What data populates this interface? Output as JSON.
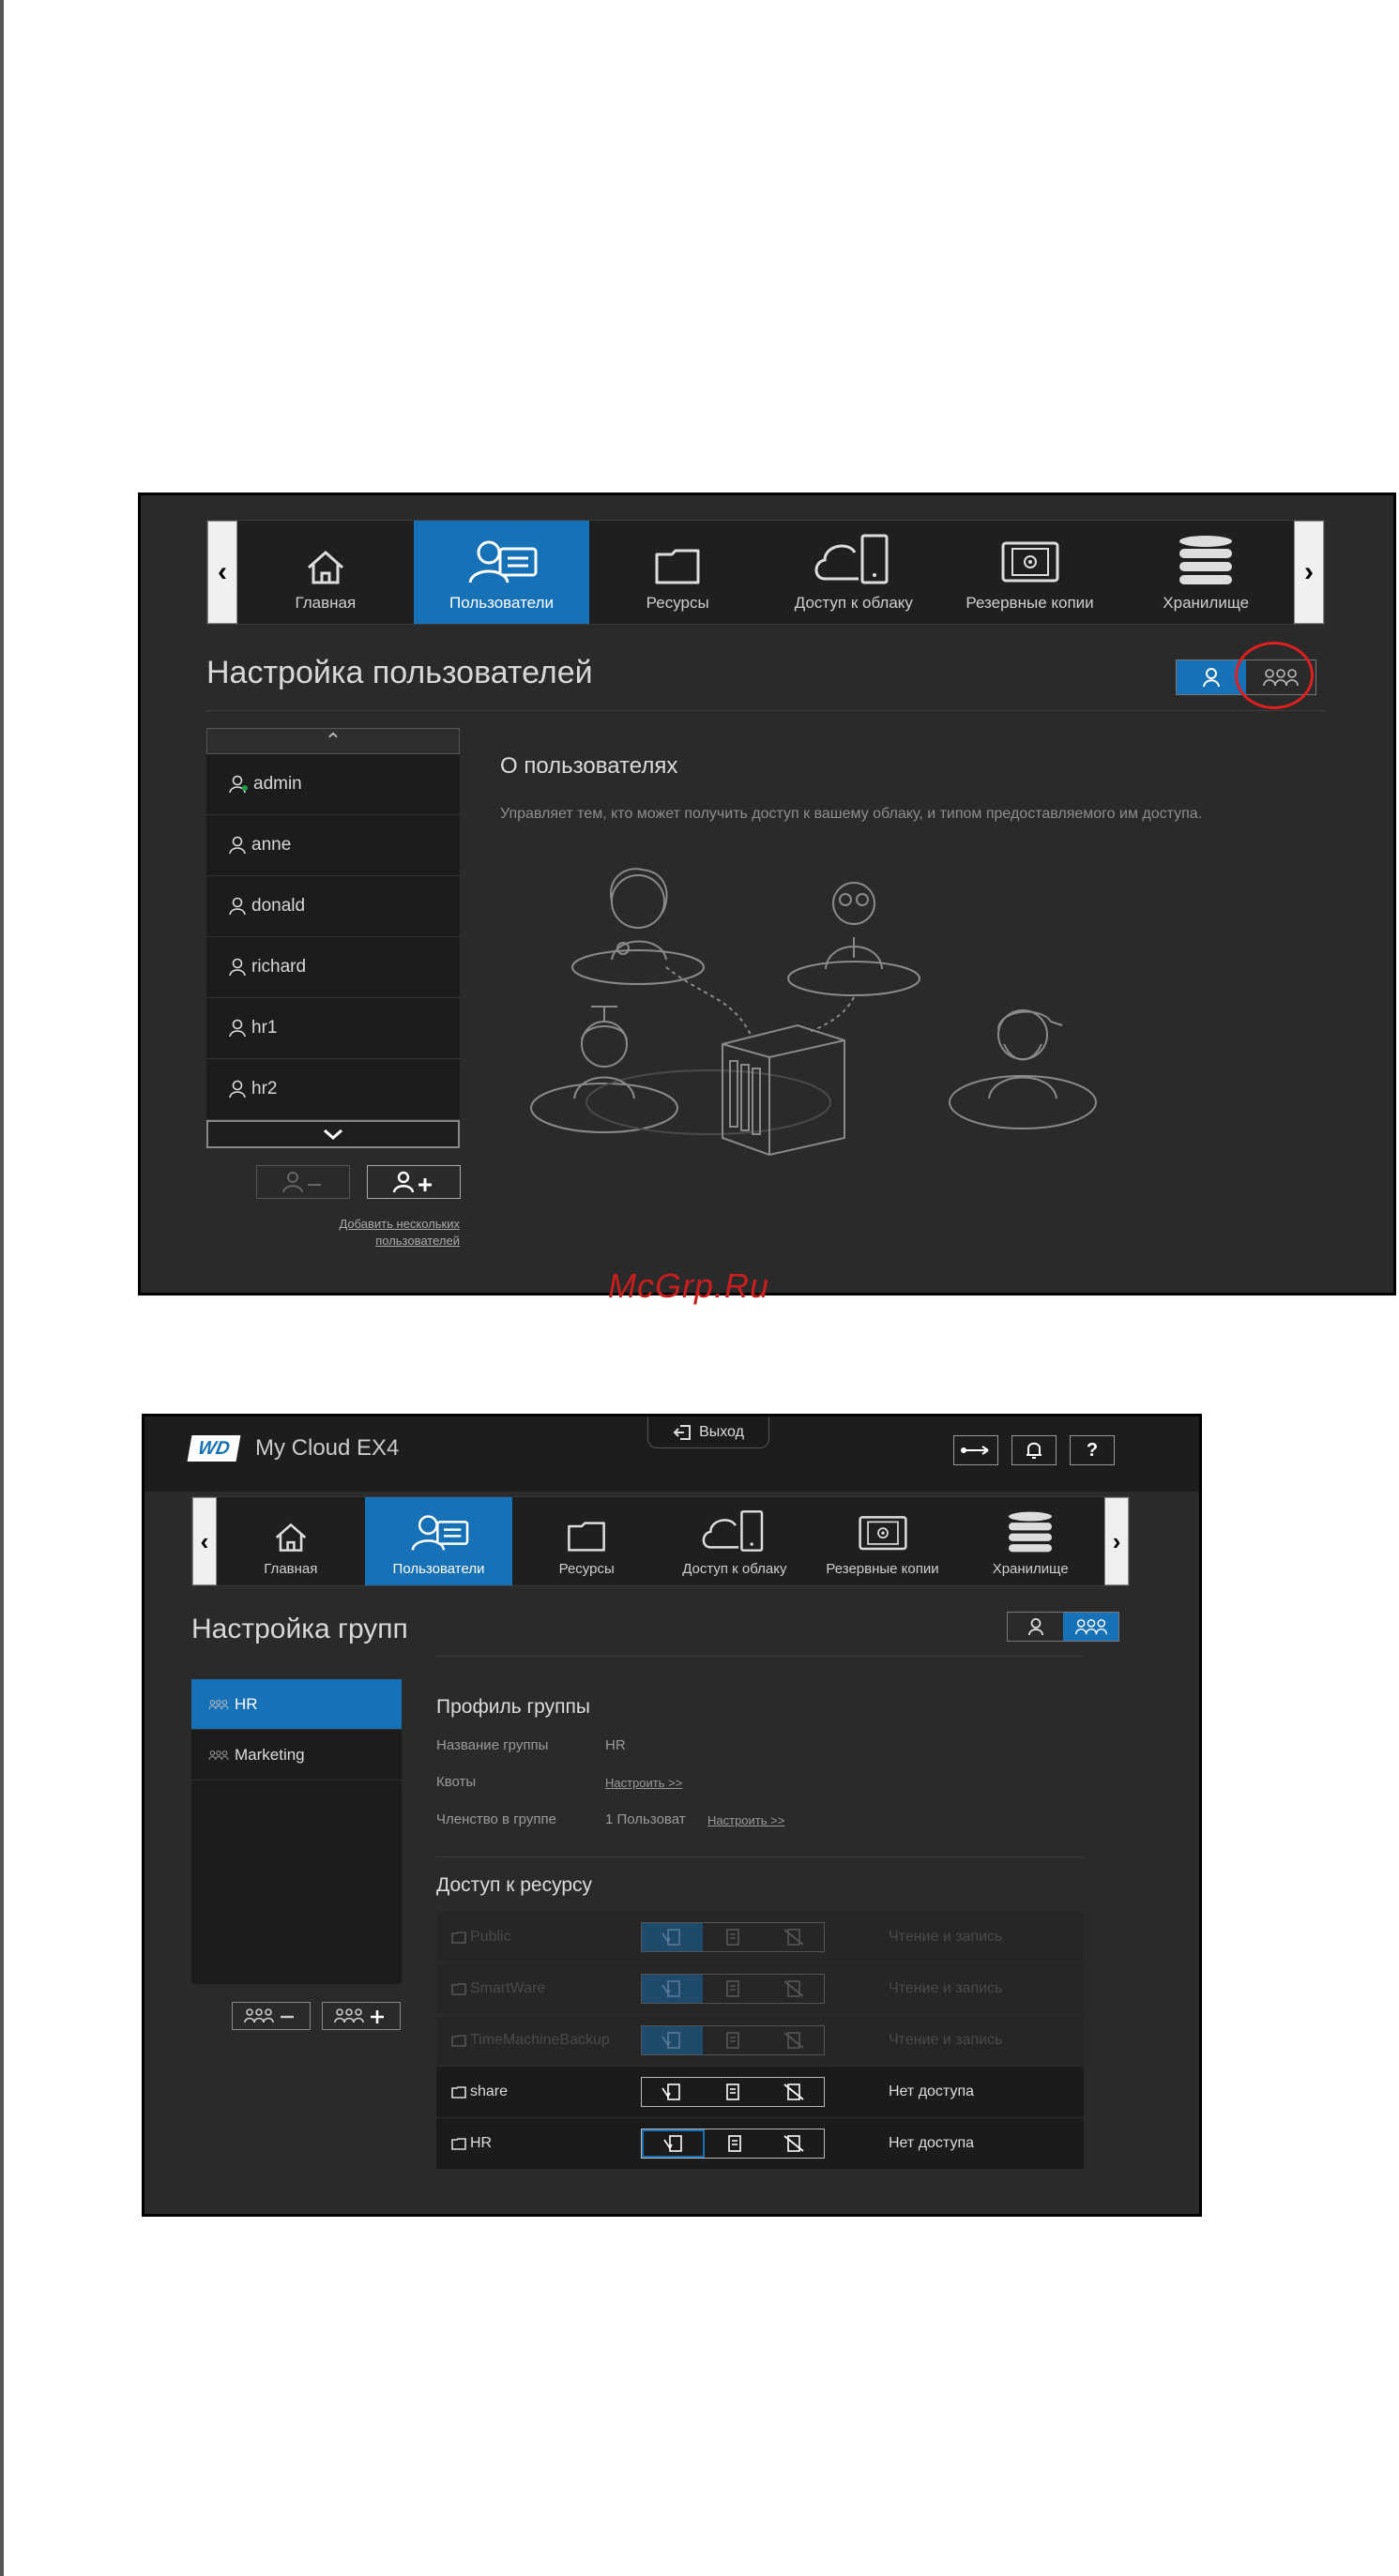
{
  "nav": {
    "items": [
      {
        "label": "Главная",
        "icon": "home-icon"
      },
      {
        "label": "Пользователи",
        "icon": "users-icon"
      },
      {
        "label": "Ресурсы",
        "icon": "folder-icon"
      },
      {
        "label": "Доступ к облаку",
        "icon": "cloud-device-icon"
      },
      {
        "label": "Резервные копии",
        "icon": "safe-icon"
      },
      {
        "label": "Хранилище",
        "icon": "storage-stack-icon"
      }
    ],
    "active": "Пользователи",
    "prev_arrow": "‹",
    "next_arrow": "›"
  },
  "users_screen": {
    "title": "Настройка пользователей",
    "users": [
      "admin",
      "anne",
      "donald",
      "richard",
      "hr1",
      "hr2"
    ],
    "add_multiple_link_line1": "Добавить нескольких",
    "add_multiple_link_line2": "пользователей",
    "about_title": "О пользователях",
    "about_text": "Управляет тем, кто может получить доступ к вашему облаку, и типом предоставляемого им доступа."
  },
  "watermark": "McGrp.Ru",
  "groups_screen": {
    "brand": "WD",
    "product": "My Cloud EX4",
    "logout": "Выход",
    "title": "Настройка групп",
    "groups": [
      "HR",
      "Marketing"
    ],
    "profile_title": "Профиль группы",
    "group_name_label": "Название группы",
    "group_name_value": "HR",
    "quotas_label": "Квоты",
    "quotas_link": "Настроить >>",
    "membership_label": "Членство в группе",
    "membership_value": "1 Пользоват",
    "membership_link": "Настроить >>",
    "access_title": "Доступ к ресурсу",
    "shares": [
      {
        "name": "Public",
        "status": "Чтение и запись",
        "enabled": false
      },
      {
        "name": "SmartWare",
        "status": "Чтение и запись",
        "enabled": false
      },
      {
        "name": "TimeMachineBackup",
        "status": "Чтение и запись",
        "enabled": false
      },
      {
        "name": "share",
        "status": "Нет доступа",
        "enabled": true
      },
      {
        "name": "HR",
        "status": "Нет доступа",
        "enabled": true
      }
    ]
  },
  "colors": {
    "accent": "#1671b6",
    "panel": "#2a2a2a",
    "highlight_circle": "#e0201e"
  }
}
